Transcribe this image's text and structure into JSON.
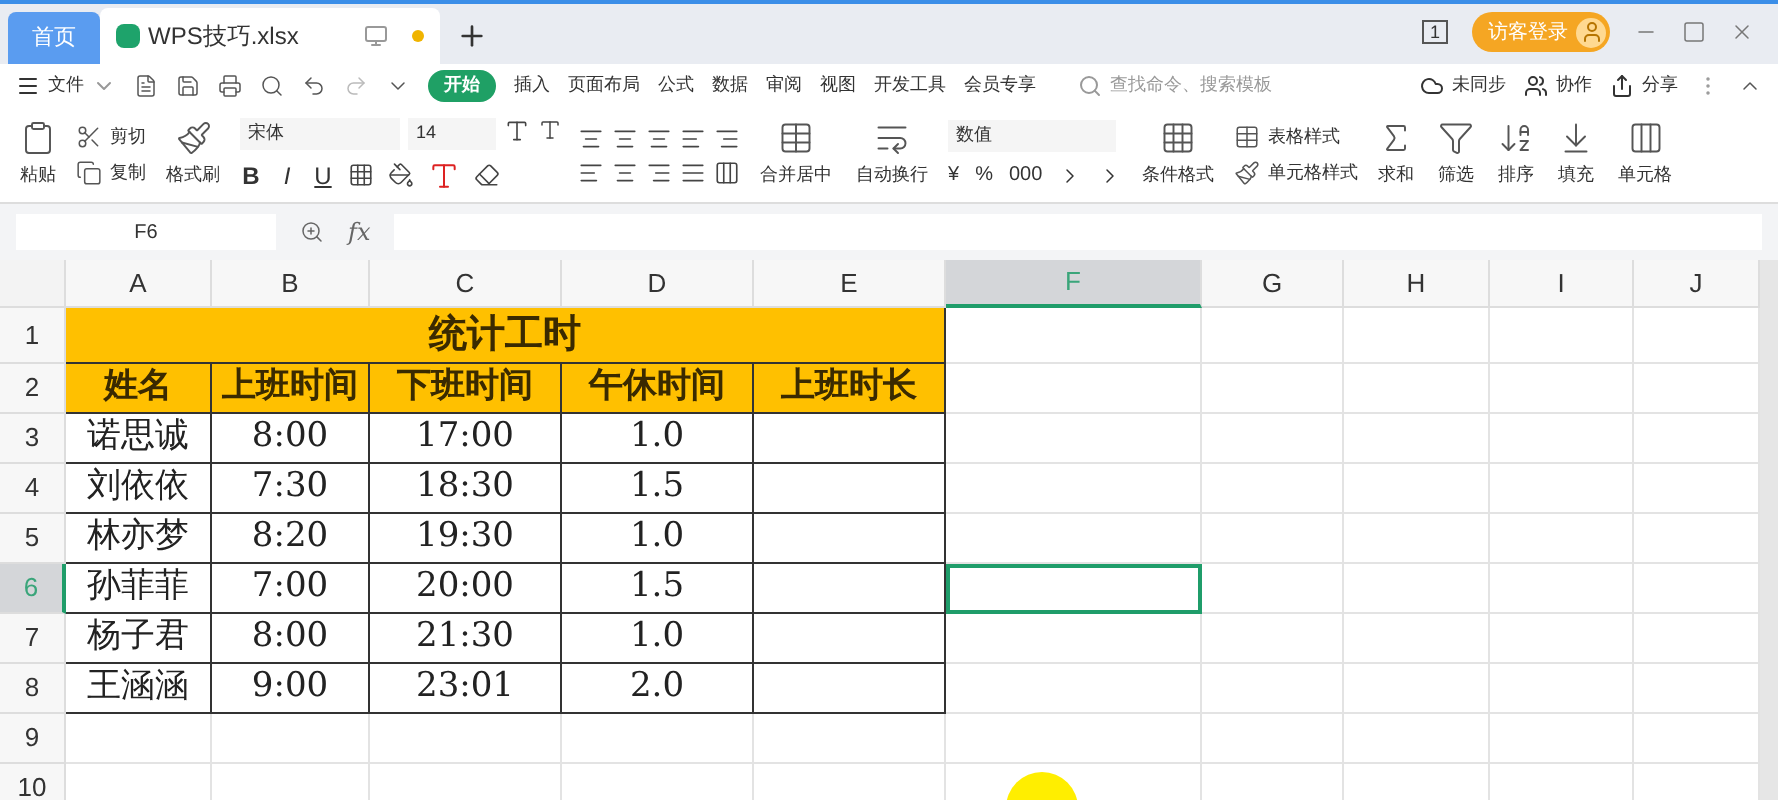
{
  "tabs": [
    {
      "label": "首页",
      "kind": "home",
      "selected": false
    },
    {
      "label": "WPS技巧.xlsx",
      "kind": "file",
      "selected": true
    }
  ],
  "window_count": "1",
  "account": "访客登录",
  "menu": {
    "file": "文件",
    "search_placeholder": "查找命令、搜索模板",
    "actions": [
      "未同步",
      "协作",
      "分享"
    ],
    "tabs": [
      {
        "label": "开始",
        "selected": true
      },
      {
        "label": "插入",
        "selected": false
      },
      {
        "label": "页面布局",
        "selected": false
      },
      {
        "label": "公式",
        "selected": false
      },
      {
        "label": "数据",
        "selected": false
      },
      {
        "label": "审阅",
        "selected": false
      },
      {
        "label": "视图",
        "selected": false
      },
      {
        "label": "开发工具",
        "selected": false
      },
      {
        "label": "会员专享",
        "selected": false
      }
    ]
  },
  "ribbon": {
    "paste": "粘贴",
    "cut": "剪切",
    "copy": "复制",
    "format_painter": "格式刷",
    "font": "宋体",
    "font_size": "14",
    "font_styles": [
      "B",
      "I",
      "U"
    ],
    "merge": "合并居中",
    "wrap": "自动换行",
    "number_format": "数值",
    "number_buttons": [
      "¥",
      "%",
      "000"
    ],
    "conditional_format": "条件格式",
    "table_style": "表格样式",
    "cell_style": "单元格样式",
    "tools": [
      "求和",
      "筛选",
      "排序",
      "填充",
      "单元格"
    ]
  },
  "name_box": "F6",
  "formula": "fx",
  "columns": [
    {
      "label": "A",
      "selected": false
    },
    {
      "label": "B",
      "selected": false
    },
    {
      "label": "C",
      "selected": false
    },
    {
      "label": "D",
      "selected": false
    },
    {
      "label": "E",
      "selected": false
    },
    {
      "label": "F",
      "selected": true
    },
    {
      "label": "G",
      "selected": false
    },
    {
      "label": "H",
      "selected": false
    },
    {
      "label": "I",
      "selected": false
    },
    {
      "label": "J",
      "selected": false
    }
  ],
  "rows": [
    {
      "header": "1",
      "kind": "title",
      "selected": false,
      "cells": [
        "统计工时"
      ]
    },
    {
      "header": "2",
      "kind": "header",
      "selected": false,
      "cells": [
        "姓名",
        "上班时间",
        "下班时间",
        "午休时间",
        "上班时长"
      ]
    },
    {
      "header": "3",
      "kind": "data",
      "selected": false,
      "cells": [
        "诺思诚",
        "8:00",
        "17:00",
        "1.0"
      ]
    },
    {
      "header": "4",
      "kind": "data",
      "selected": false,
      "cells": [
        "刘依依",
        "7:30",
        "18:30",
        "1.5"
      ]
    },
    {
      "header": "5",
      "kind": "data",
      "selected": false,
      "cells": [
        "林亦梦",
        "8:20",
        "19:30",
        "1.0"
      ]
    },
    {
      "header": "6",
      "kind": "data",
      "selected": true,
      "cells": [
        "孙菲菲",
        "7:00",
        "20:00",
        "1.5"
      ]
    },
    {
      "header": "7",
      "kind": "data",
      "selected": false,
      "cells": [
        "杨子君",
        "8:00",
        "21:30",
        "1.0"
      ]
    },
    {
      "header": "8",
      "kind": "data",
      "selected": false,
      "cells": [
        "王涵涵",
        "9:00",
        "23:01",
        "2.0"
      ]
    },
    {
      "header": "9",
      "kind": "empty",
      "selected": false,
      "cells": []
    },
    {
      "header": "10",
      "kind": "empty",
      "selected": false,
      "cells": []
    }
  ]
}
